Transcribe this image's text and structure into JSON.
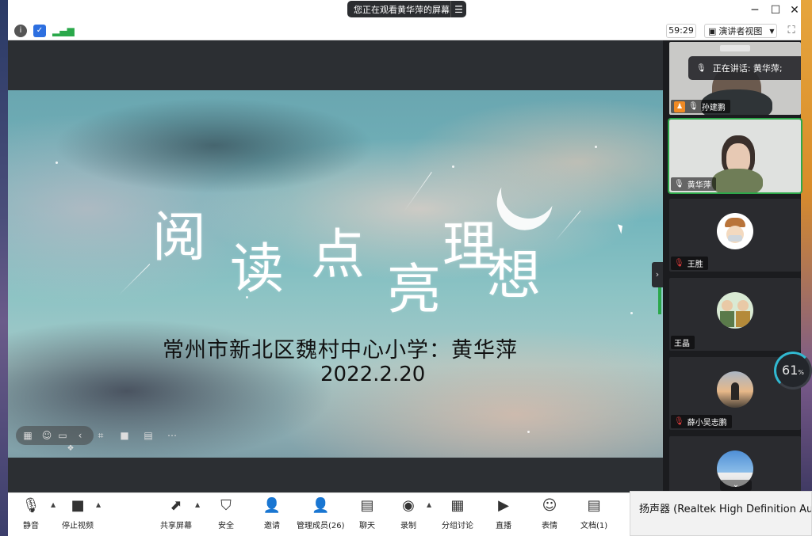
{
  "banner": {
    "text": "您正在观看黄华萍的屏幕",
    "menu_icon": "hamburger-icon"
  },
  "window_controls": {
    "minimize": "─",
    "maximize": "☐",
    "close": "✕"
  },
  "toolbar": {
    "timer": "59:29",
    "view_label": "演讲者视图"
  },
  "slide": {
    "title_chars": [
      "阅",
      "读",
      "点",
      "亮",
      "理",
      "想"
    ],
    "subtitle": "常州市新北区魏村中心小学：黄华萍",
    "date": "2022.2.20"
  },
  "participants": {
    "speaking_tip": "正在讲话: 黄华萍;",
    "tiles": [
      {
        "name": "孙建鹏",
        "mic": "on",
        "host_icon": true
      },
      {
        "name": "黄华萍",
        "mic": "on"
      },
      {
        "name": "王胜",
        "mic": "muted"
      },
      {
        "name": "王晶",
        "mic": "none"
      },
      {
        "name": "薛小吴志鹏",
        "mic": "muted"
      },
      {
        "name": "",
        "mic": "none"
      }
    ]
  },
  "bottom_bar": {
    "mute": "静音",
    "stop_video": "停止视频",
    "share_screen": "共享屏幕",
    "security": "安全",
    "invite": "邀请",
    "manage_members": "管理成员(26)",
    "chat": "聊天",
    "record": "录制",
    "breakout": "分组讨论",
    "live": "直播",
    "reactions": "表情",
    "docs": "文档(1)"
  },
  "speaker_popup": {
    "text": "扬声器 (Realtek High Definition Audio"
  },
  "cpu_gauge": {
    "value": "61",
    "unit": "%"
  },
  "colors": {
    "active_border": "#2ea84a",
    "accent_orange": "#f08a24",
    "muted_red": "#e03b3b"
  }
}
